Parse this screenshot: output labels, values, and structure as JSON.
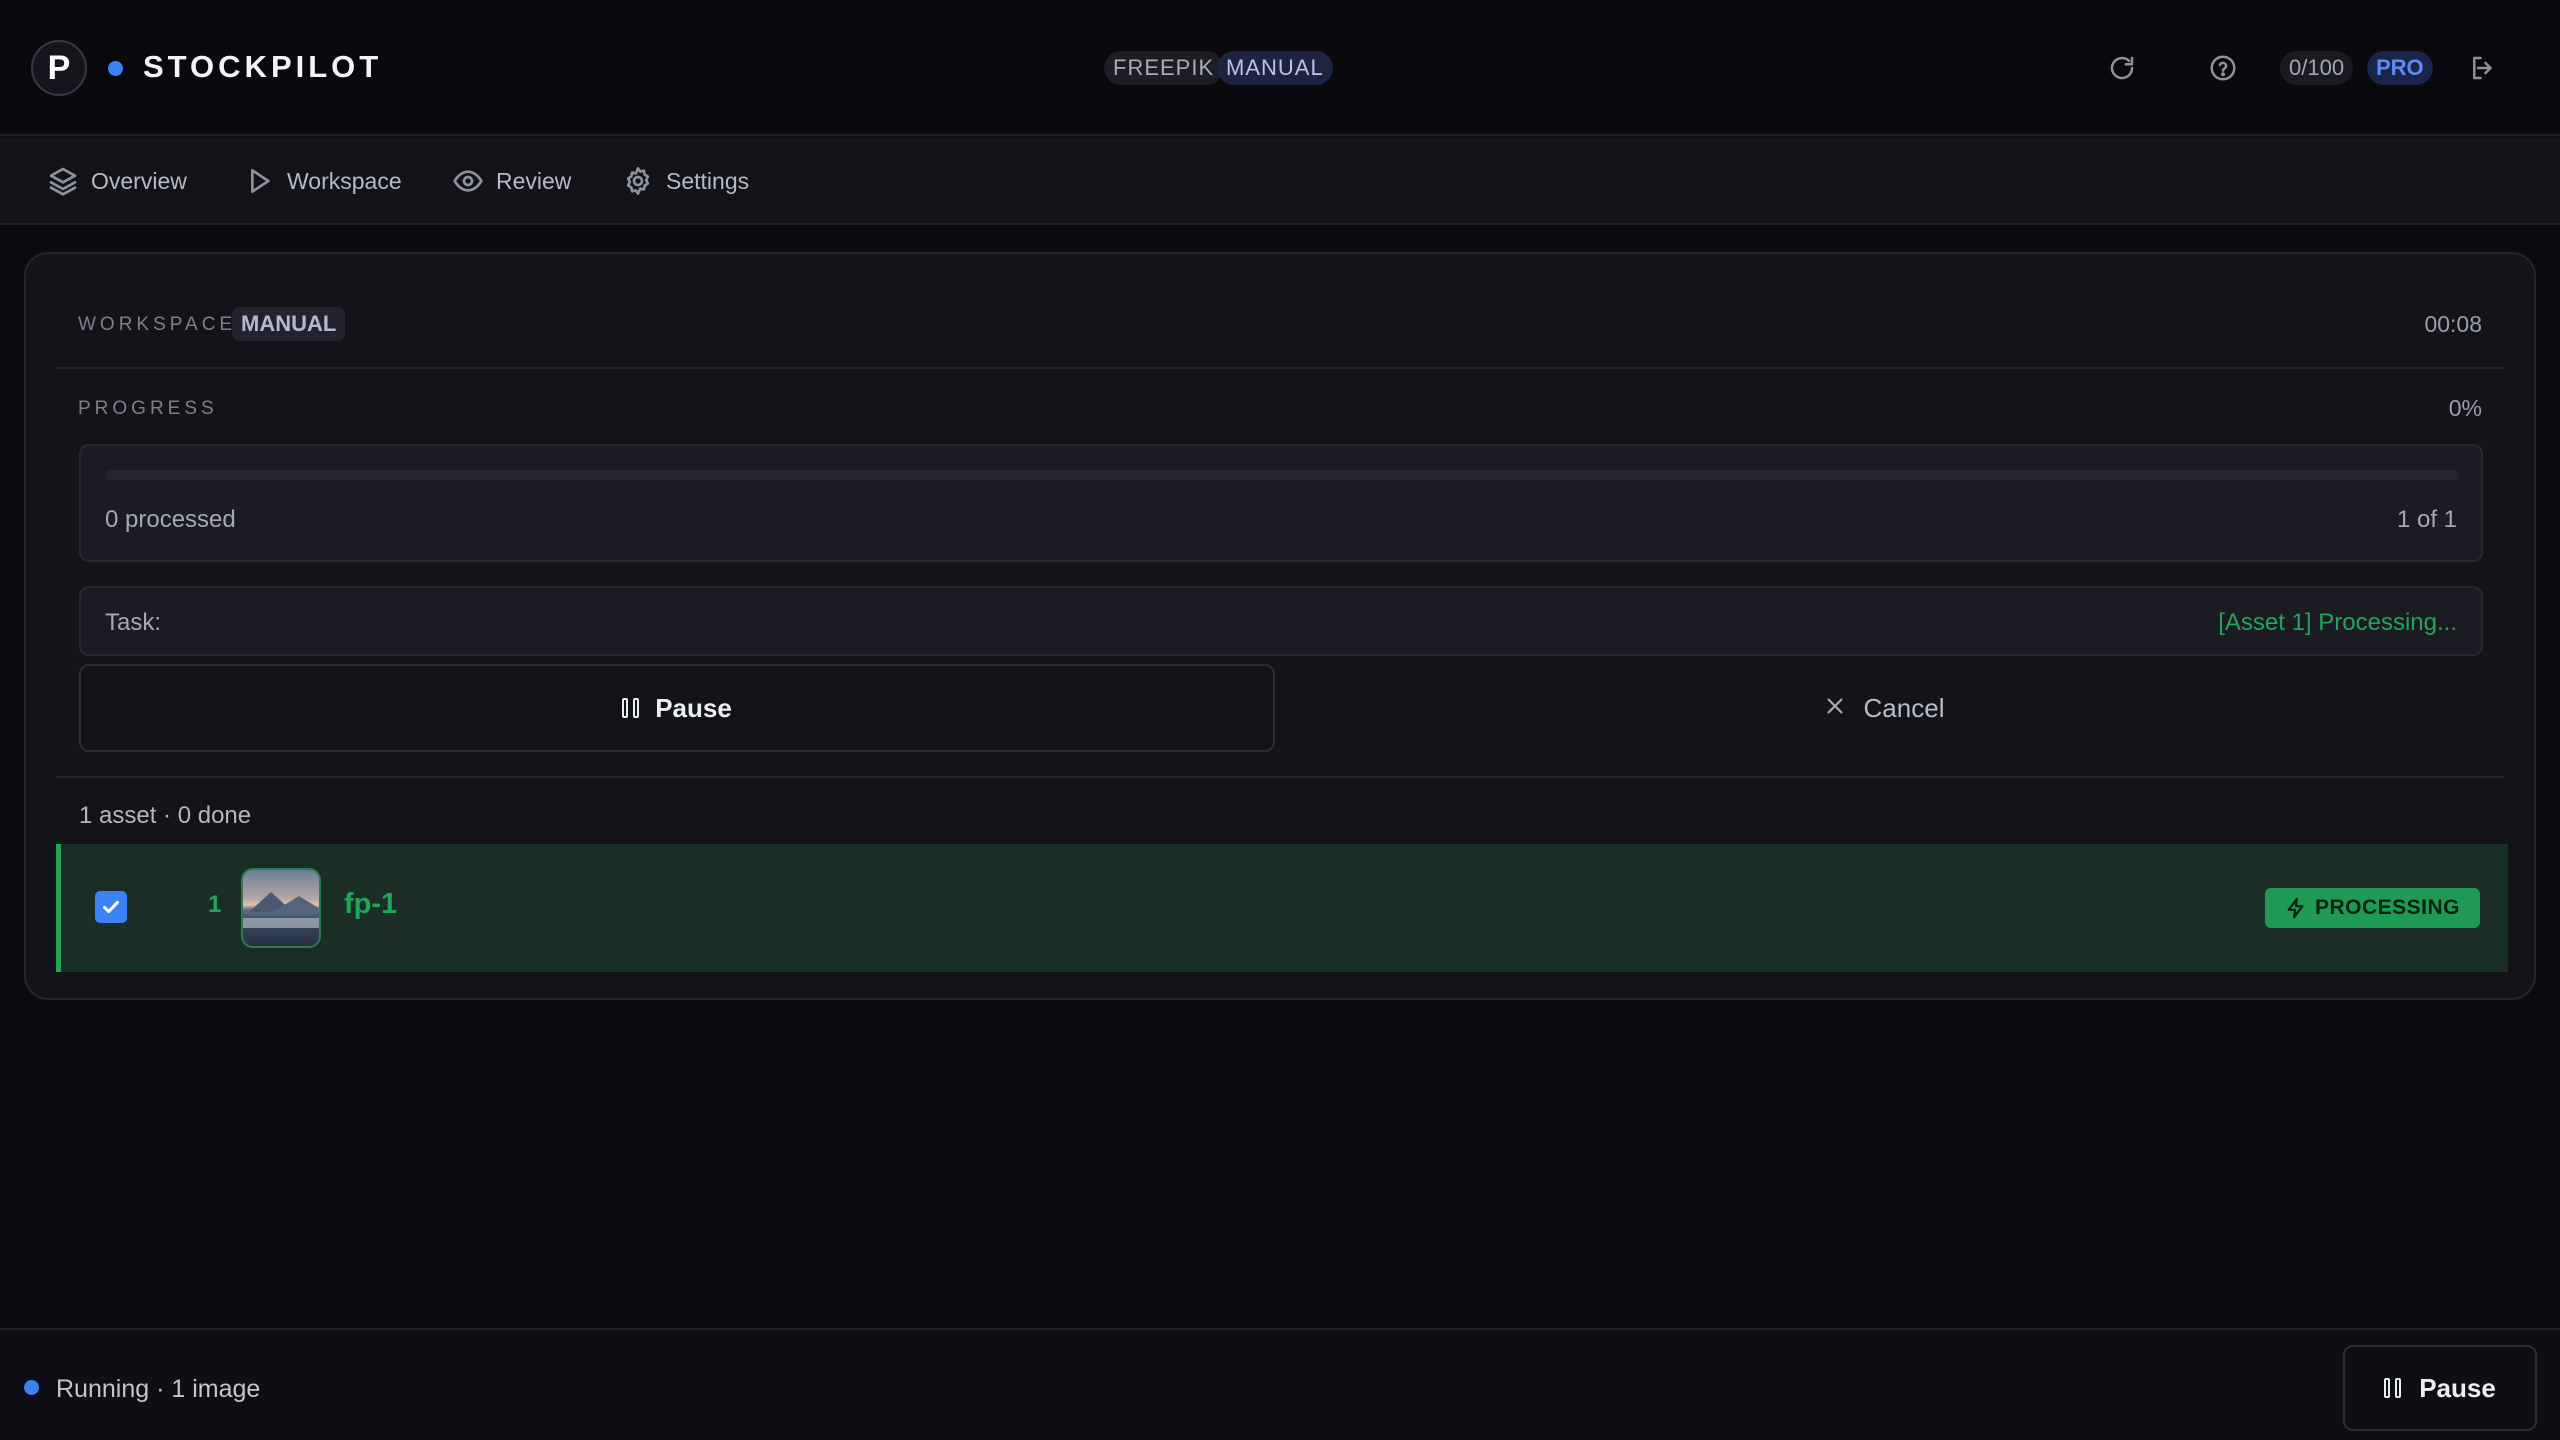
{
  "header": {
    "logo_letter": "P",
    "brand": "STOCKPILOT",
    "source_chip": "FREEPIK",
    "mode_chip": "MANUAL",
    "credits": "0/100",
    "plan": "PRO",
    "icons": [
      "refresh-icon",
      "help-icon",
      "logout-icon"
    ]
  },
  "nav": {
    "items": [
      {
        "label": "Overview",
        "icon": "layers-icon"
      },
      {
        "label": "Workspace",
        "icon": "play-icon"
      },
      {
        "label": "Review",
        "icon": "eye-icon"
      },
      {
        "label": "Settings",
        "icon": "gear-icon"
      }
    ]
  },
  "workspace": {
    "label": "WORKSPACE",
    "mode": "MANUAL",
    "timer": "00:08"
  },
  "progress": {
    "label": "PROGRESS",
    "percent_text": "0%",
    "fraction": 0,
    "processed": "0 processed",
    "position": "1 of 1"
  },
  "task": {
    "label": "Task:",
    "value": "[Asset 1] Processing..."
  },
  "actions": {
    "pause": "Pause",
    "cancel": "Cancel"
  },
  "assets": {
    "summary": "1 asset · 0 done",
    "rows": [
      {
        "index": "1",
        "name": "fp-1",
        "status": "PROCESSING",
        "checked": true
      }
    ]
  },
  "footer": {
    "status": "Running · 1 image",
    "pause": "Pause"
  },
  "colors": {
    "accent": "#3b82f6",
    "success": "#22a559",
    "background": "#0c0c10"
  }
}
